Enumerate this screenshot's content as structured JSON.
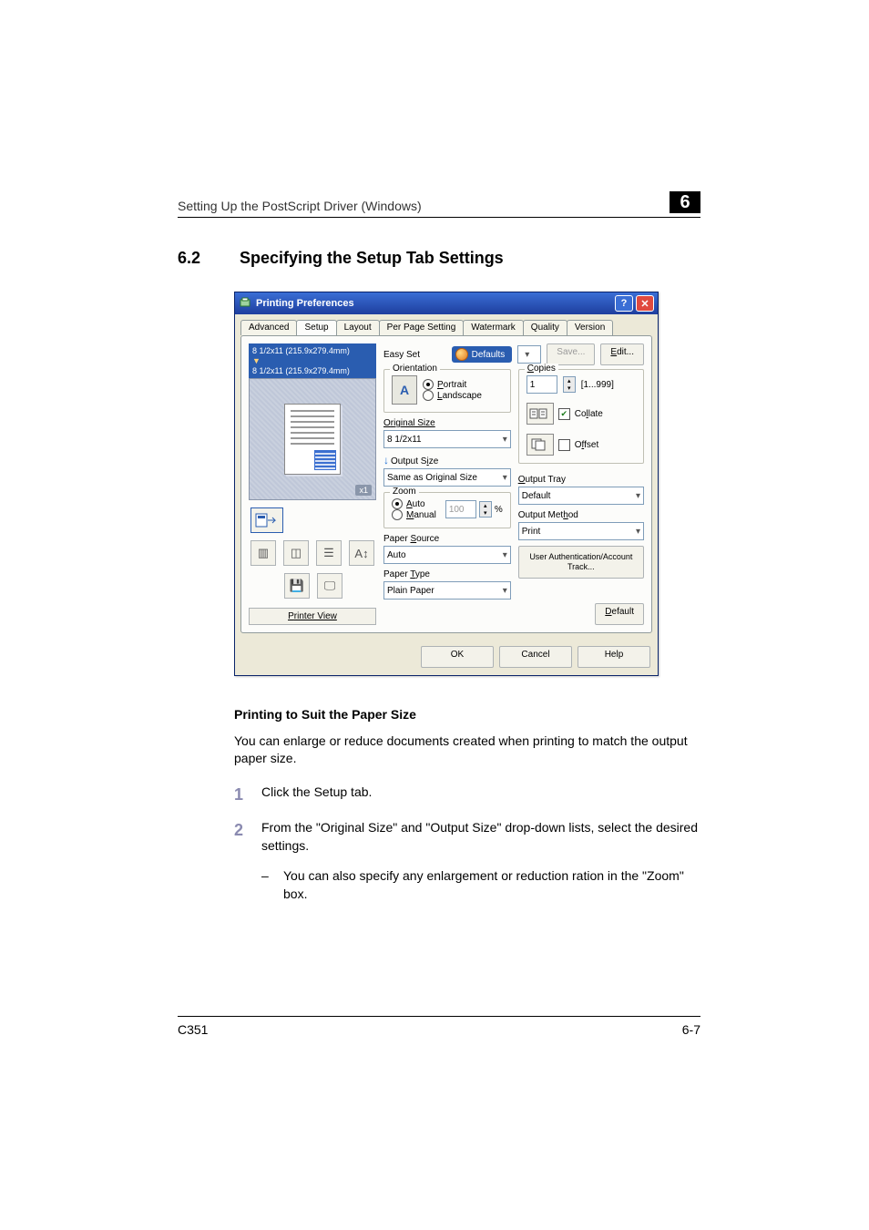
{
  "header": {
    "running_title": "Setting Up the PostScript Driver (Windows)",
    "chapter_num": "6"
  },
  "section": {
    "num": "6.2",
    "title": "Specifying the Setup Tab Settings"
  },
  "subheading": "Printing to Suit the Paper Size",
  "paragraph": "You can enlarge or reduce documents created when printing to match the output paper size.",
  "steps": {
    "s1": {
      "n": "1",
      "text": "Click the Setup tab."
    },
    "s2": {
      "n": "2",
      "text": "From the \"Original Size\" and \"Output Size\" drop-down lists, select the desired settings."
    },
    "sub1": {
      "dash": "–",
      "text": "You can also specify any enlargement or reduction ration in the \"Zoom\" box."
    }
  },
  "footer": {
    "model": "C351",
    "page": "6-7"
  },
  "dlg": {
    "title": "Printing Preferences",
    "tabs": {
      "t1": "Advanced",
      "t2": "Setup",
      "t3": "Layout",
      "t4": "Per Page Setting",
      "t5": "Watermark",
      "t6": "Quality",
      "t7": "Version"
    },
    "preview": {
      "line1": "8 1/2x11 (215.9x279.4mm)",
      "line2": "8 1/2x11 (215.9x279.4mm)",
      "zoom_badge": "x1",
      "printer_view": "Printer View"
    },
    "easy_set": {
      "label": "Easy Set",
      "defaults": "Defaults",
      "save": "Save...",
      "edit": "Edit..."
    },
    "orientation": {
      "caption": "Orientation",
      "portrait": "Portrait",
      "landscape": "Landscape"
    },
    "original_size": {
      "label": "Original Size",
      "value": "8 1/2x11"
    },
    "output_size": {
      "label": "Output Size",
      "value": "Same as Original Size"
    },
    "zoom": {
      "caption": "Zoom",
      "auto": "Auto",
      "manual": "Manual",
      "value": "100",
      "pct": "%"
    },
    "paper_source": {
      "label": "Paper Source",
      "value": "Auto"
    },
    "paper_type": {
      "label": "Paper Type",
      "value": "Plain Paper"
    },
    "copies": {
      "caption": "Copies",
      "value": "1",
      "range": "[1...999]",
      "collate": "Collate",
      "offset": "Offset"
    },
    "output_tray": {
      "label": "Output Tray",
      "value": "Default"
    },
    "output_method": {
      "label": "Output Method",
      "value": "Print"
    },
    "uat": "User Authentication/Account Track...",
    "default_btn": "Default",
    "buttons": {
      "ok": "OK",
      "cancel": "Cancel",
      "help": "Help"
    }
  }
}
